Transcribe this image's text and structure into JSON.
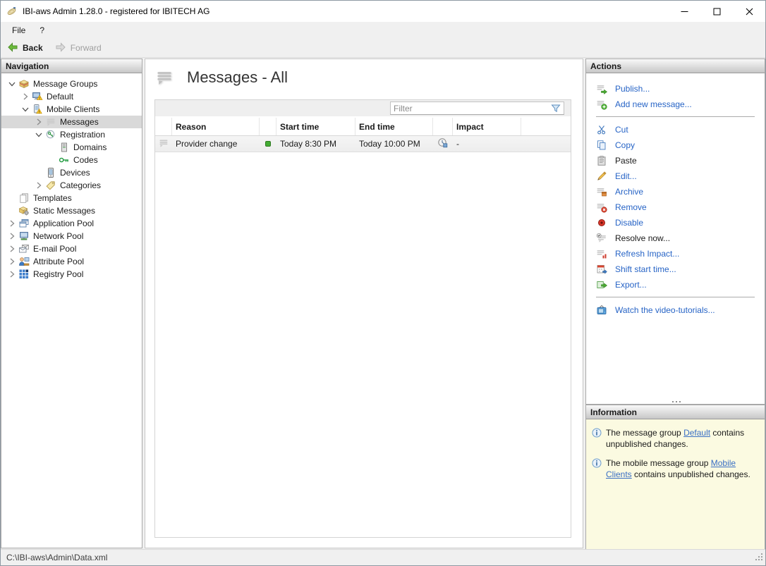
{
  "titlebar": {
    "title": "IBI-aws Admin 1.28.0 - registered for IBITECH AG",
    "app_icon": "ibi-aws-app-icon",
    "controls": [
      "minimize",
      "maximize",
      "close"
    ]
  },
  "menubar": {
    "items": [
      {
        "label": "File"
      },
      {
        "label": "?"
      }
    ]
  },
  "toolbar": {
    "back": {
      "label": "Back",
      "icon": "back-arrow-icon",
      "enabled": true
    },
    "forward": {
      "label": "Forward",
      "icon": "forward-arrow-icon",
      "enabled": false
    }
  },
  "navigation": {
    "header": "Navigation",
    "items": [
      {
        "label": "Message Groups",
        "level": 0,
        "expanded": true,
        "icon": "message-groups-icon"
      },
      {
        "label": "Default",
        "level": 1,
        "expanded": false,
        "icon": "monitor-warning-icon"
      },
      {
        "label": "Mobile Clients",
        "level": 1,
        "expanded": true,
        "icon": "mobile-warning-icon"
      },
      {
        "label": "Messages",
        "level": 2,
        "expanded": false,
        "icon": "messages-icon",
        "selected": true
      },
      {
        "label": "Registration",
        "level": 2,
        "expanded": true,
        "icon": "registration-icon"
      },
      {
        "label": "Domains",
        "level": 3,
        "expanded": null,
        "icon": "domains-icon"
      },
      {
        "label": "Codes",
        "level": 3,
        "expanded": null,
        "icon": "codes-icon"
      },
      {
        "label": "Devices",
        "level": 2,
        "expanded": null,
        "icon": "devices-icon"
      },
      {
        "label": "Categories",
        "level": 2,
        "expanded": false,
        "icon": "categories-icon"
      },
      {
        "label": "Templates",
        "level": 0,
        "expanded": null,
        "icon": "templates-icon"
      },
      {
        "label": "Static Messages",
        "level": 0,
        "expanded": null,
        "icon": "static-messages-icon"
      },
      {
        "label": "Application Pool",
        "level": 0,
        "expanded": false,
        "icon": "application-pool-icon"
      },
      {
        "label": "Network Pool",
        "level": 0,
        "expanded": false,
        "icon": "network-pool-icon"
      },
      {
        "label": "E-mail Pool",
        "level": 0,
        "expanded": false,
        "icon": "email-pool-icon"
      },
      {
        "label": "Attribute Pool",
        "level": 0,
        "expanded": false,
        "icon": "attribute-pool-icon"
      },
      {
        "label": "Registry Pool",
        "level": 0,
        "expanded": false,
        "icon": "registry-pool-icon"
      }
    ]
  },
  "main": {
    "title": "Messages - All",
    "title_icon": "messages-icon",
    "filter": {
      "placeholder": "Filter",
      "icon": "filter-funnel-icon"
    },
    "table": {
      "columns": [
        {
          "label": ""
        },
        {
          "label": "Reason"
        },
        {
          "label": ""
        },
        {
          "label": "Start time"
        },
        {
          "label": "End time"
        },
        {
          "label": ""
        },
        {
          "label": "Impact"
        }
      ],
      "rows": [
        {
          "icon": "message-icon",
          "reason": "Provider change",
          "status_icon": "green-dot-icon",
          "start_time": "Today 8:30 PM",
          "end_time": "Today 10:00 PM",
          "impact_icon": "impact-clock-icon",
          "impact": "-"
        }
      ]
    }
  },
  "actions": {
    "header": "Actions",
    "groups": [
      {
        "items": [
          {
            "label": "Publish...",
            "icon": "publish-icon",
            "enabled": true
          },
          {
            "label": "Add new message...",
            "icon": "add-message-icon",
            "enabled": true
          }
        ]
      },
      {
        "items": [
          {
            "label": "Cut",
            "icon": "cut-icon",
            "enabled": true
          },
          {
            "label": "Copy",
            "icon": "copy-icon",
            "enabled": true
          },
          {
            "label": "Paste",
            "icon": "paste-icon",
            "enabled": false
          },
          {
            "label": "Edit...",
            "icon": "edit-icon",
            "enabled": true
          },
          {
            "label": "Archive",
            "icon": "archive-icon",
            "enabled": true
          },
          {
            "label": "Remove",
            "icon": "remove-icon",
            "enabled": true
          },
          {
            "label": "Disable",
            "icon": "disable-icon",
            "enabled": true
          },
          {
            "label": "Resolve now...",
            "icon": "resolve-icon",
            "enabled": false
          },
          {
            "label": "Refresh Impact...",
            "icon": "refresh-impact-icon",
            "enabled": true
          },
          {
            "label": "Shift start time...",
            "icon": "shift-start-time-icon",
            "enabled": true
          },
          {
            "label": "Export...",
            "icon": "export-icon",
            "enabled": true
          }
        ]
      },
      {
        "items": [
          {
            "label": "Watch the video-tutorials...",
            "icon": "video-tutorials-icon",
            "enabled": true
          }
        ]
      }
    ]
  },
  "information": {
    "header": "Information",
    "items": [
      {
        "icon": "info-icon",
        "pre": "The message group ",
        "link": "Default",
        "post": " contains unpublished changes."
      },
      {
        "icon": "info-icon",
        "pre": "The mobile message group ",
        "link": "Mobile Clients",
        "post": " contains unpublished changes."
      }
    ]
  },
  "statusbar": {
    "path": "C:\\IBI-aws\\Admin\\Data.xml"
  }
}
